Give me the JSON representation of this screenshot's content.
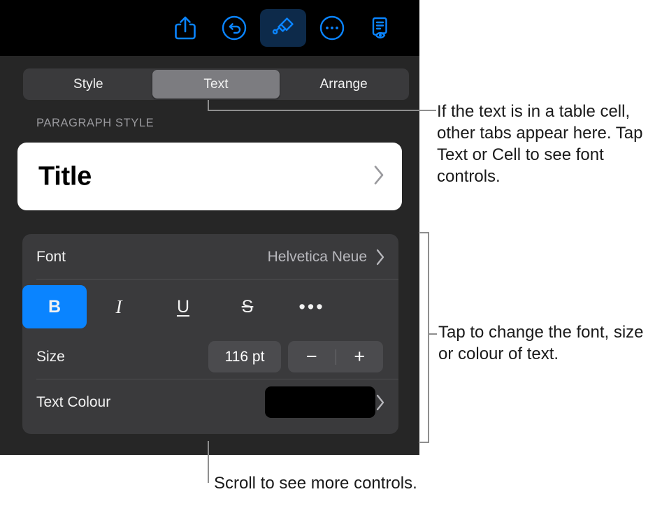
{
  "toolbar": {
    "items": [
      {
        "name": "share-icon",
        "label": "Share"
      },
      {
        "name": "undo-icon",
        "label": "Undo"
      },
      {
        "name": "format-brush-icon",
        "label": "Format",
        "active": true
      },
      {
        "name": "more-options-icon",
        "label": "More"
      },
      {
        "name": "document-view-icon",
        "label": "Document Options"
      }
    ]
  },
  "tabs": {
    "items": [
      {
        "label": "Style",
        "selected": false
      },
      {
        "label": "Text",
        "selected": true
      },
      {
        "label": "Arrange",
        "selected": false
      }
    ]
  },
  "paragraph_style": {
    "section_label": "PARAGRAPH STYLE",
    "value": "Title",
    "chevron": "chevron-right-icon"
  },
  "format": {
    "font": {
      "label": "Font",
      "value": "Helvetica Neue",
      "chevron": "chevron-right-icon"
    },
    "style_buttons": [
      {
        "name": "bold-button",
        "label": "B",
        "active": true
      },
      {
        "name": "italic-button",
        "label": "I",
        "active": false
      },
      {
        "name": "underline-button",
        "label": "U",
        "active": false
      },
      {
        "name": "strikethrough-button",
        "label": "S",
        "active": false
      },
      {
        "name": "more-text-styles-button",
        "label": "•••",
        "active": false
      }
    ],
    "size": {
      "label": "Size",
      "value": "116 pt",
      "decrement": "−",
      "increment": "+"
    },
    "text_colour": {
      "label": "Text Colour",
      "swatch_colour": "#000000",
      "chevron": "chevron-right-icon"
    }
  },
  "callouts": {
    "tabs_note": "If the text is in a table cell, other tabs appear here. Tap Text or Cell to see font controls.",
    "font_note": "Tap to change the font, size or colour of text.",
    "scroll_note": "Scroll to see more controls."
  },
  "colours": {
    "accent": "#0a84ff",
    "panel_bg": "#262626",
    "card_bg": "#3a3a3c",
    "toolbar_bg": "#000000",
    "selected_tab": "#7c7c80",
    "callout_line": "#8e8e8e"
  }
}
